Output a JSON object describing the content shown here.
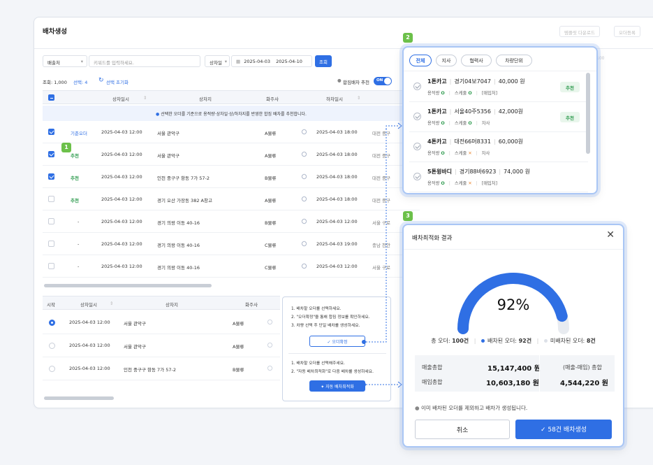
{
  "window": {
    "title": "배차생성",
    "top_buttons": [
      "템플릿 다운로드",
      "오더등록"
    ]
  },
  "filters": {
    "owner": "배출처",
    "keyword_placeholder": "키워드를 입력하세요.",
    "date_type": "상차일",
    "date_from": "2025-04-03",
    "date_to": "2025-04-10",
    "search": "조회"
  },
  "summary": {
    "count_label": "조회: 1,000",
    "selected_label": "선택: 4",
    "reset_label": "선택 초기화",
    "combine_label": "합짐배차 추천",
    "toggle_label": "ON"
  },
  "table": {
    "headers": [
      "상차일시",
      "상차지",
      "화주사",
      "하차일시"
    ],
    "info": "선택한 오더를 기준으로 용적량·상차일·상/하차지를 반영한 합짐 배차를 추천합니다.",
    "rows": [
      {
        "tag": "기준오더",
        "date": "2025-04-03 12:00",
        "place": "서울 관악구",
        "owner": "A물류",
        "unload": "2025-04-03 18:00",
        "dest": "대전 중구"
      },
      {
        "tag": "추천",
        "date": "2025-04-03 12:00",
        "place": "서울 관악구",
        "owner": "A물류",
        "unload": "2025-04-03 18:00",
        "dest": "대전 중구"
      },
      {
        "tag": "추천",
        "date": "2025-04-03 12:00",
        "place": "인천 중구구 항동 7가 57-2",
        "owner": "B물류",
        "unload": "2025-04-03 18:00",
        "dest": "대전 중구"
      },
      {
        "tag": "추천",
        "date": "2025-04-03 12:00",
        "place": "경기 오산 가장동 382 A창고",
        "owner": "A물류",
        "unload": "2025-04-03 18:00",
        "dest": "대전 중구"
      },
      {
        "tag": "-",
        "date": "2025-04-03 12:00",
        "place": "경기 의왕 이동 40-16",
        "owner": "B물류",
        "unload": "2025-04-03 12:00",
        "dest": "서울 구로"
      },
      {
        "tag": "-",
        "date": "2025-04-03 12:00",
        "place": "경기 의왕 이동 40-16",
        "owner": "C물류",
        "unload": "2025-04-03 19:00",
        "dest": "충남 천안"
      },
      {
        "tag": "-",
        "date": "2025-04-03 12:00",
        "place": "경기 의왕 이동 40-16",
        "owner": "C물류",
        "unload": "2025-04-03 12:00",
        "dest": "서울 구로"
      }
    ]
  },
  "bottom_table": {
    "headers": [
      "시작",
      "상차일시",
      "상차지",
      "화주사"
    ],
    "rows": [
      {
        "date": "2025-04-03 12:00",
        "place": "서울 관악구",
        "owner": "A물류"
      },
      {
        "date": "2025-04-03 12:00",
        "place": "서울 관악구",
        "owner": "A물류"
      },
      {
        "date": "2025-04-03 12:00",
        "place": "인천 중구구 항동 7가 57-2",
        "owner": "B물류"
      }
    ]
  },
  "guide": {
    "a1": "1. 배차할 오더를 선택하세요.",
    "a2": "2. \"오더확정\"을 통해 합짐 정보를 확인하세요.",
    "a3": "3. 차량 선택 후 단일 배차를 생성하세요.",
    "confirm_button": "오더확정",
    "b1": "1. 배차할 오더를 선택해주세요.",
    "b2": "2. \"자동 배차최적화\"로 다중 배차를 생성하세요.",
    "auto_button": "자동 배차최적화"
  },
  "badges": [
    "1",
    "2",
    "3"
  ],
  "vehicle_popup": {
    "tabs": [
      "전체",
      "지사",
      "협력사",
      "차량단위"
    ],
    "items": [
      {
        "type": "1톤카고",
        "plate": "경기04보7047",
        "price": "40,000 원",
        "vol_label": "용적량",
        "vol_ok": true,
        "key_label": "스케줄",
        "key_ok": true,
        "kind": "[매입처]",
        "recommend": "추천"
      },
      {
        "type": "1톤카고",
        "plate": "서울40주5356",
        "price": "42,000원",
        "vol_label": "용적량",
        "vol_ok": true,
        "key_label": "스케줄",
        "key_ok": true,
        "kind": "자사",
        "recommend": "추천"
      },
      {
        "type": "4톤카고",
        "plate": "대전66머8331",
        "price": "60,000원",
        "vol_label": "용적량",
        "vol_ok": true,
        "key_label": "스케줄",
        "key_ok": false,
        "kind": "자사",
        "recommend": ""
      },
      {
        "type": "5톤윙바디",
        "plate": "경기88바6923",
        "price": "74,000 원",
        "vol_label": "용적량",
        "vol_ok": true,
        "key_label": "스케줄",
        "key_ok": false,
        "kind": "[매입처]",
        "recommend": ""
      }
    ]
  },
  "result_popup": {
    "title": "배차최적화 결과",
    "percent_value": 0.92,
    "percent": "92%",
    "total_label": "총 오더:",
    "total_value": "100건",
    "dispatched_label": "배차된 오더:",
    "dispatched_value": "92건",
    "undispatched_label": "미배차된 오더:",
    "undispatched_value": "8건",
    "sales_label": "매출총합",
    "sales_value": "15,147,400 원",
    "purchase_label": "매입총합",
    "purchase_value": "10,603,180 원",
    "margin_label": "(매출-매입) 총합",
    "margin_value": "4,544,220 원",
    "notice": "이미 배차된 오더를 제외하고 배차가 생성됩니다.",
    "cancel": "취소",
    "create": "58건 배차생성",
    "colors": {
      "accent": "#2f6fe4",
      "track": "#e8ebf0"
    }
  }
}
